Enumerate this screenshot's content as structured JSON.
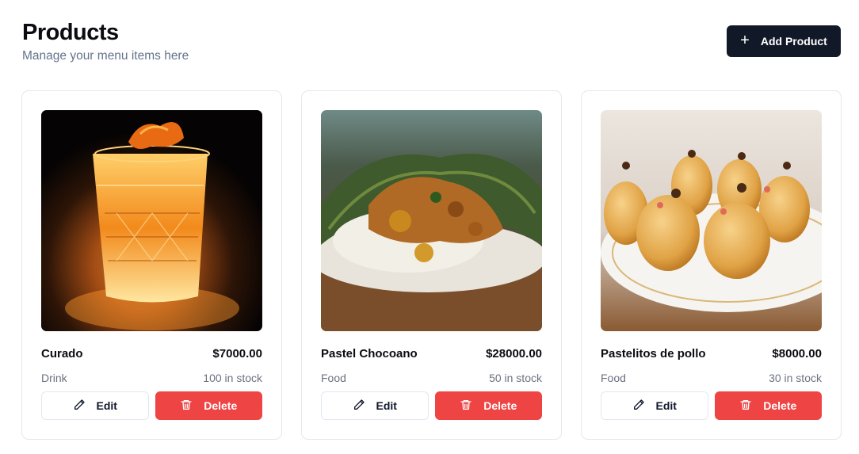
{
  "header": {
    "title": "Products",
    "subtitle": "Manage your menu items here",
    "add_button_label": "Add Product"
  },
  "icons": {
    "add": "plus-icon",
    "edit": "pencil-icon",
    "delete": "trash-icon"
  },
  "colors": {
    "primary": "#111827",
    "danger": "#ef4444",
    "muted": "#6b7280"
  },
  "products": [
    {
      "name": "Curado",
      "price": "$7000.00",
      "category": "Drink",
      "stock": "100 in stock",
      "edit_label": "Edit",
      "delete_label": "Delete"
    },
    {
      "name": "Pastel Chocoano",
      "price": "$28000.00",
      "category": "Food",
      "stock": "50 in stock",
      "edit_label": "Edit",
      "delete_label": "Delete"
    },
    {
      "name": "Pastelitos de pollo",
      "price": "$8000.00",
      "category": "Food",
      "stock": "30 in stock",
      "edit_label": "Edit",
      "delete_label": "Delete"
    }
  ]
}
